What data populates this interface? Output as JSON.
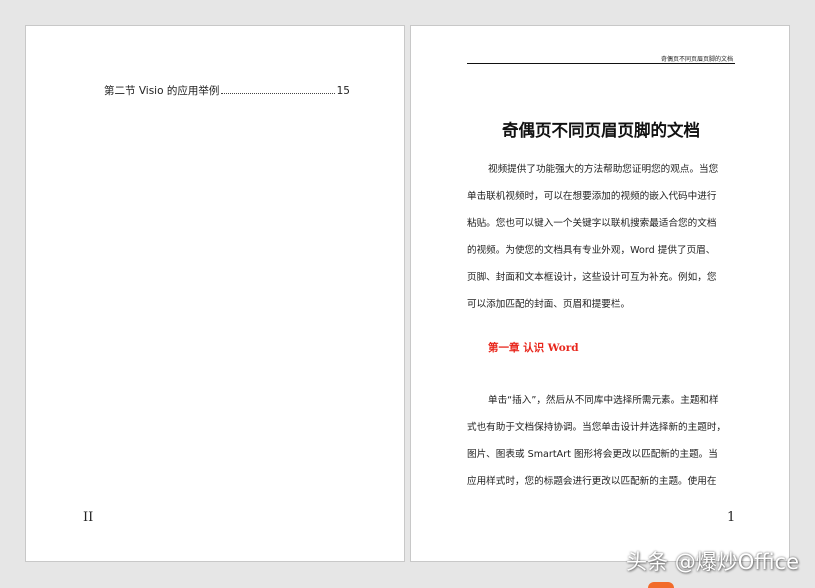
{
  "left_page": {
    "toc_entry": {
      "label": "第二节 Visio 的应用举例",
      "page": "15"
    },
    "page_number": "II"
  },
  "right_page": {
    "header": "奇偶页不同页眉页脚的文档",
    "title": "奇偶页不同页眉页脚的文档",
    "paragraph_1": [
      "视频提供了功能强大的方法帮助您证明您的观点。当您",
      "单击联机视频时，可以在想要添加的视频的嵌入代码中进行",
      "粘贴。您也可以键入一个关键字以联机搜索最适合您的文档",
      "的视频。为使您的文档具有专业外观，Word 提供了页眉、",
      "页脚、封面和文本框设计，这些设计可互为补充。例如，您",
      "可以添加匹配的封面、页眉和提要栏。"
    ],
    "chapter_heading": "第一章  认识 Word",
    "paragraph_2": [
      "单击“插入”，然后从不同库中选择所需元素。主题和样",
      "式也有助于文档保持协调。当您单击设计并选择新的主题时，",
      "图片、图表或 SmartArt 图形将会更改以匹配新的主题。当",
      "应用样式时，您的标题会进行更改以匹配新的主题。使用在"
    ],
    "page_number": "1"
  },
  "watermark": "头条 @爆炒Office",
  "colors": {
    "chapter_heading": "#e8261c",
    "background": "#e6e6e6",
    "page": "#ffffff",
    "watermark_accent": "#f26b2a"
  }
}
